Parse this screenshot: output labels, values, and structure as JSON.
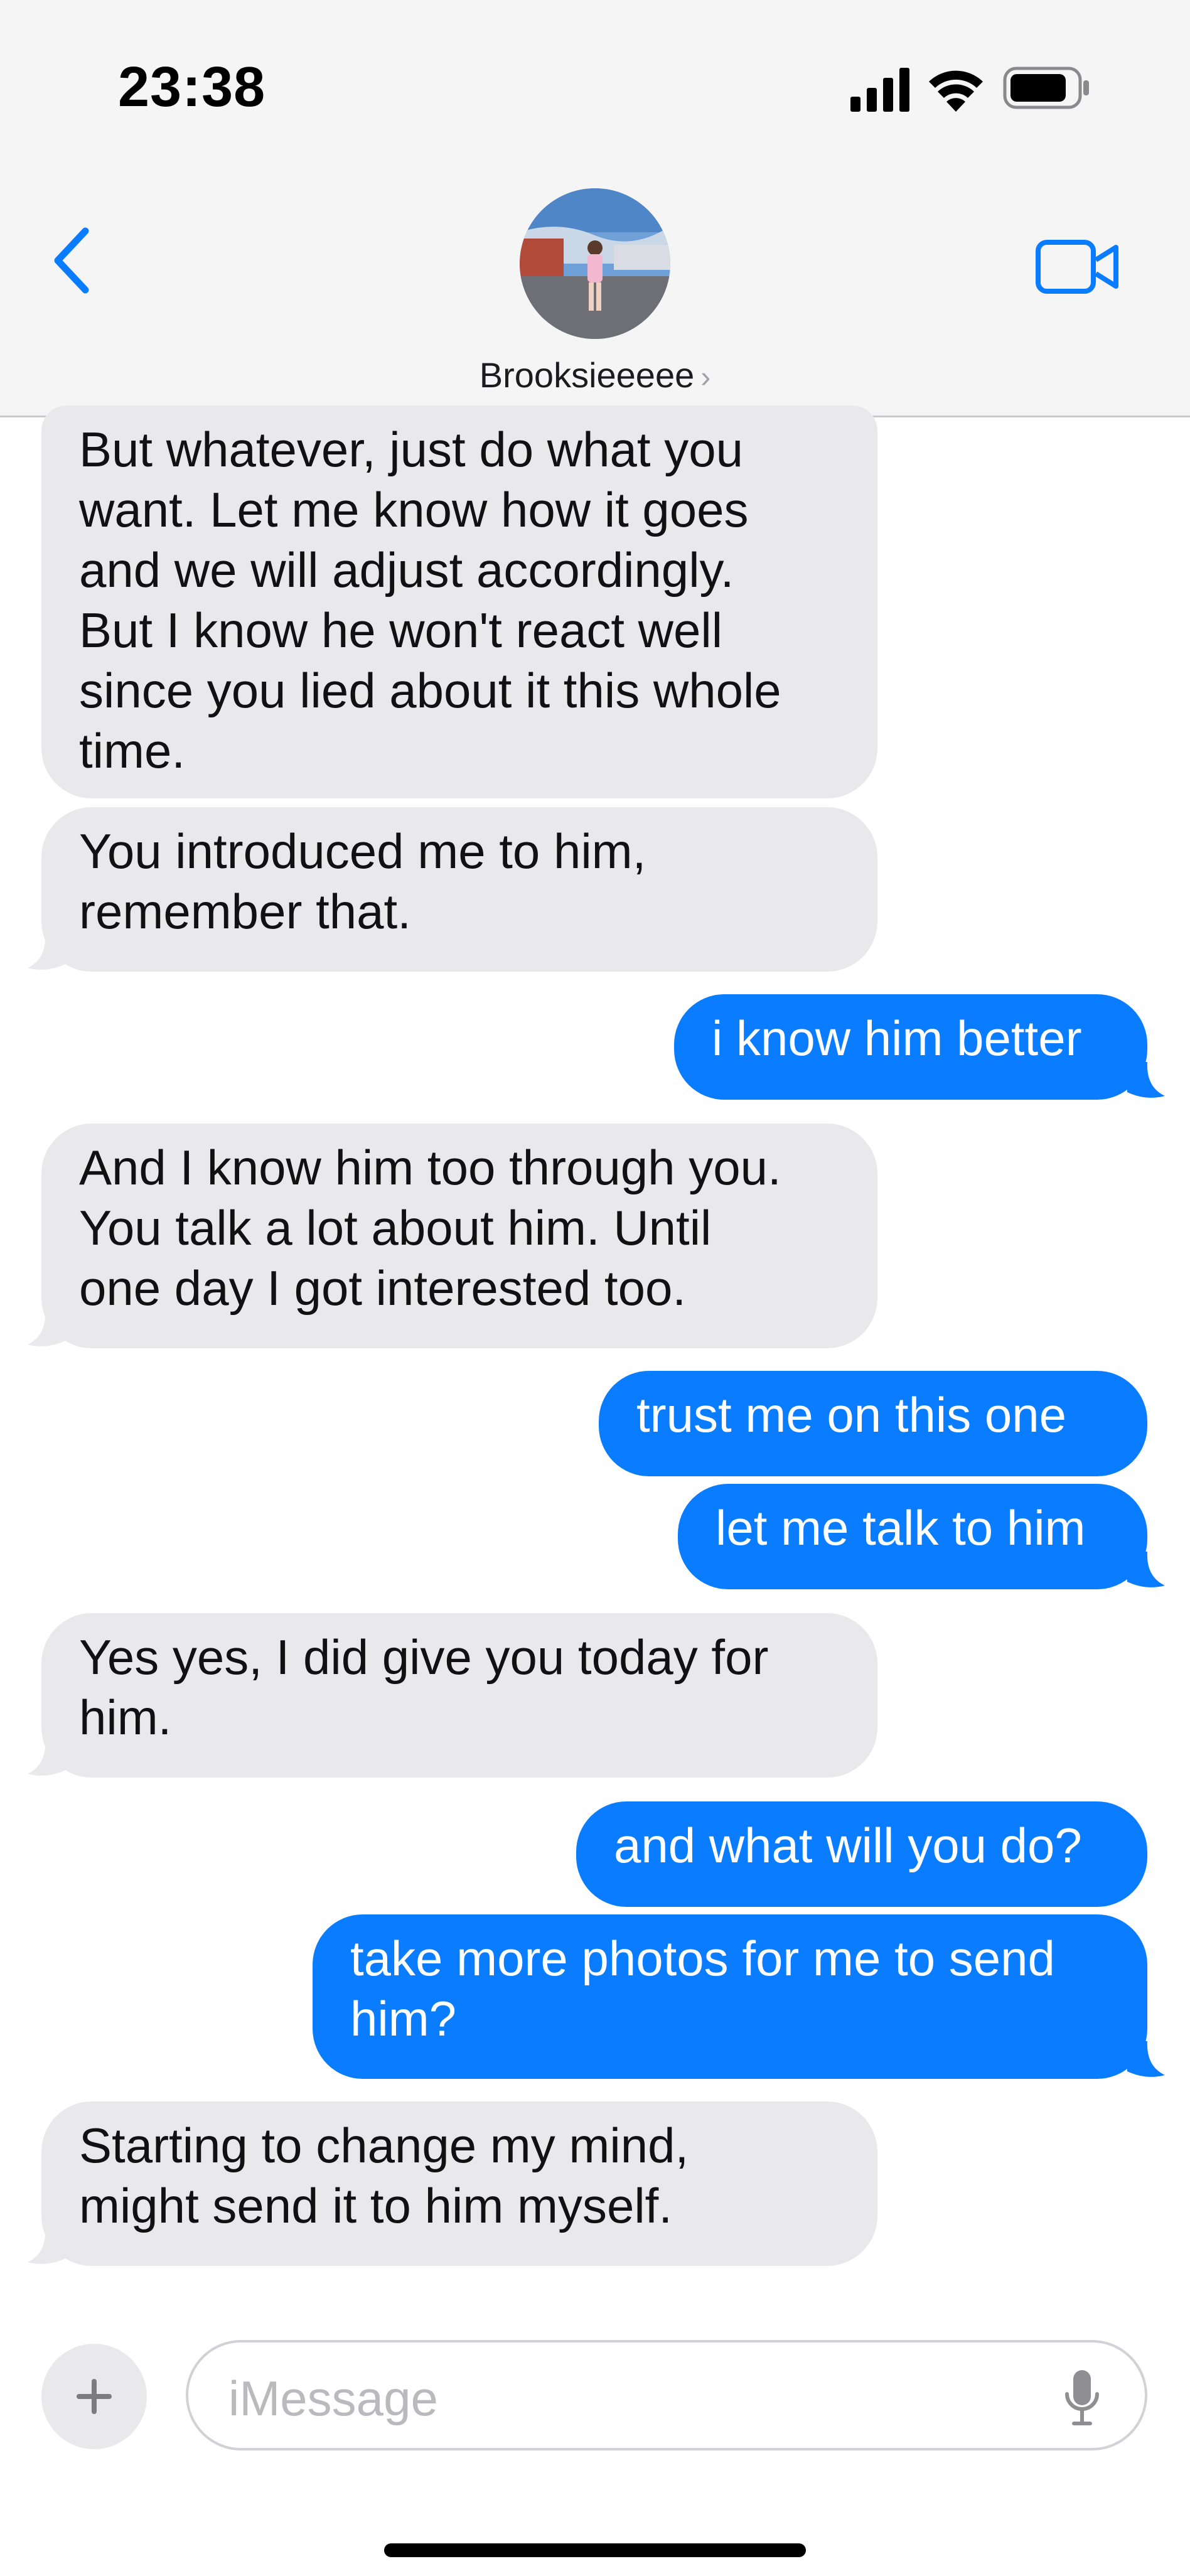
{
  "status_bar": {
    "time": "23:38"
  },
  "header": {
    "contact_name": "Brooksieeeee",
    "chevron": "›"
  },
  "messages": [
    {
      "side": "in",
      "text": "But whatever, just do what you\nwant. Let me know how it goes\nand we will adjust accordingly.\nBut I know he won't react well\nsince you lied about it this whole\ntime."
    },
    {
      "side": "in",
      "text": "You introduced me to him,\nremember that."
    },
    {
      "side": "out",
      "text": "i know him better"
    },
    {
      "side": "in",
      "text": "And I know him too through you.\nYou talk a lot about him. Until\none day I got interested too."
    },
    {
      "side": "out",
      "text": "trust me on this one"
    },
    {
      "side": "out",
      "text": "let me talk to him"
    },
    {
      "side": "in",
      "text": "Yes yes, I did give you today for\nhim."
    },
    {
      "side": "out",
      "text": "and what will you do?"
    },
    {
      "side": "out",
      "text": "take more photos for me to send\nhim?"
    },
    {
      "side": "in",
      "text": "Starting to change my mind,\nmight send it to him myself."
    }
  ],
  "composer": {
    "placeholder": "iMessage",
    "plus_label": "+"
  },
  "icons": {
    "back": "chevron-left-icon",
    "video": "video-camera-icon",
    "mic": "microphone-icon",
    "plus": "plus-icon"
  },
  "colors": {
    "accent": "#0a7cff",
    "incoming_bubble": "#e9e9eb",
    "header_bg": "#f5f5f5"
  }
}
